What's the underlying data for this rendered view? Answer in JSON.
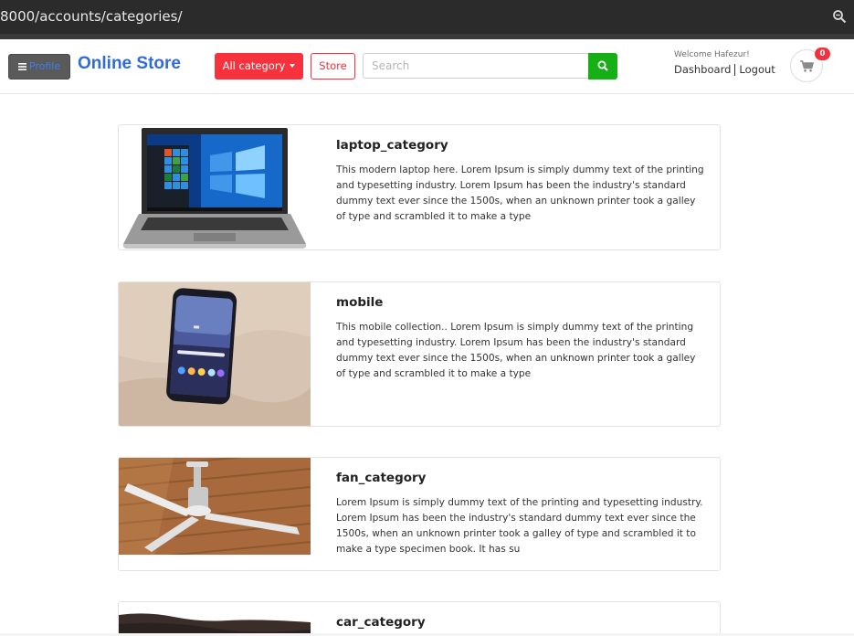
{
  "browser": {
    "url": "8000/accounts/categories/",
    "zoom_icon": "zoom-icon"
  },
  "header": {
    "profile_label": "Profile",
    "brand": "Online Store",
    "all_category_label": "All category",
    "store_label": "Store",
    "search_placeholder": "Search",
    "search_value": "",
    "welcome": "Welcome Hafezur!",
    "dashboard_label": "Dashboard",
    "logout_label": "Logout",
    "cart_count": "0"
  },
  "categories": [
    {
      "title": "laptop_category",
      "description": "This modern laptop here. Lorem Ipsum is simply dummy text of the printing and typesetting industry. Lorem Ipsum has been the industry's standard dummy text ever since the 1500s, when an unknown printer took a galley of type and scrambled it to make a type"
    },
    {
      "title": "mobile",
      "description": "This mobile collection.. Lorem Ipsum is simply dummy text of the printing and typesetting industry. Lorem Ipsum has been the industry's standard dummy text ever since the 1500s, when an unknown printer took a galley of type and scrambled it to make a type"
    },
    {
      "title": "fan_category",
      "description": "Lorem Ipsum is simply dummy text of the printing and typesetting industry. Lorem Ipsum has been the industry's standard dummy text ever since the 1500s, when an unknown printer took a galley of type and scrambled it to make a type specimen book. It has su"
    },
    {
      "title": "car_category",
      "description": ""
    }
  ],
  "colors": {
    "brand": "#2f6cd6",
    "danger": "#f8323c",
    "success": "#16b016",
    "profile_button": "#5a5a5a"
  }
}
